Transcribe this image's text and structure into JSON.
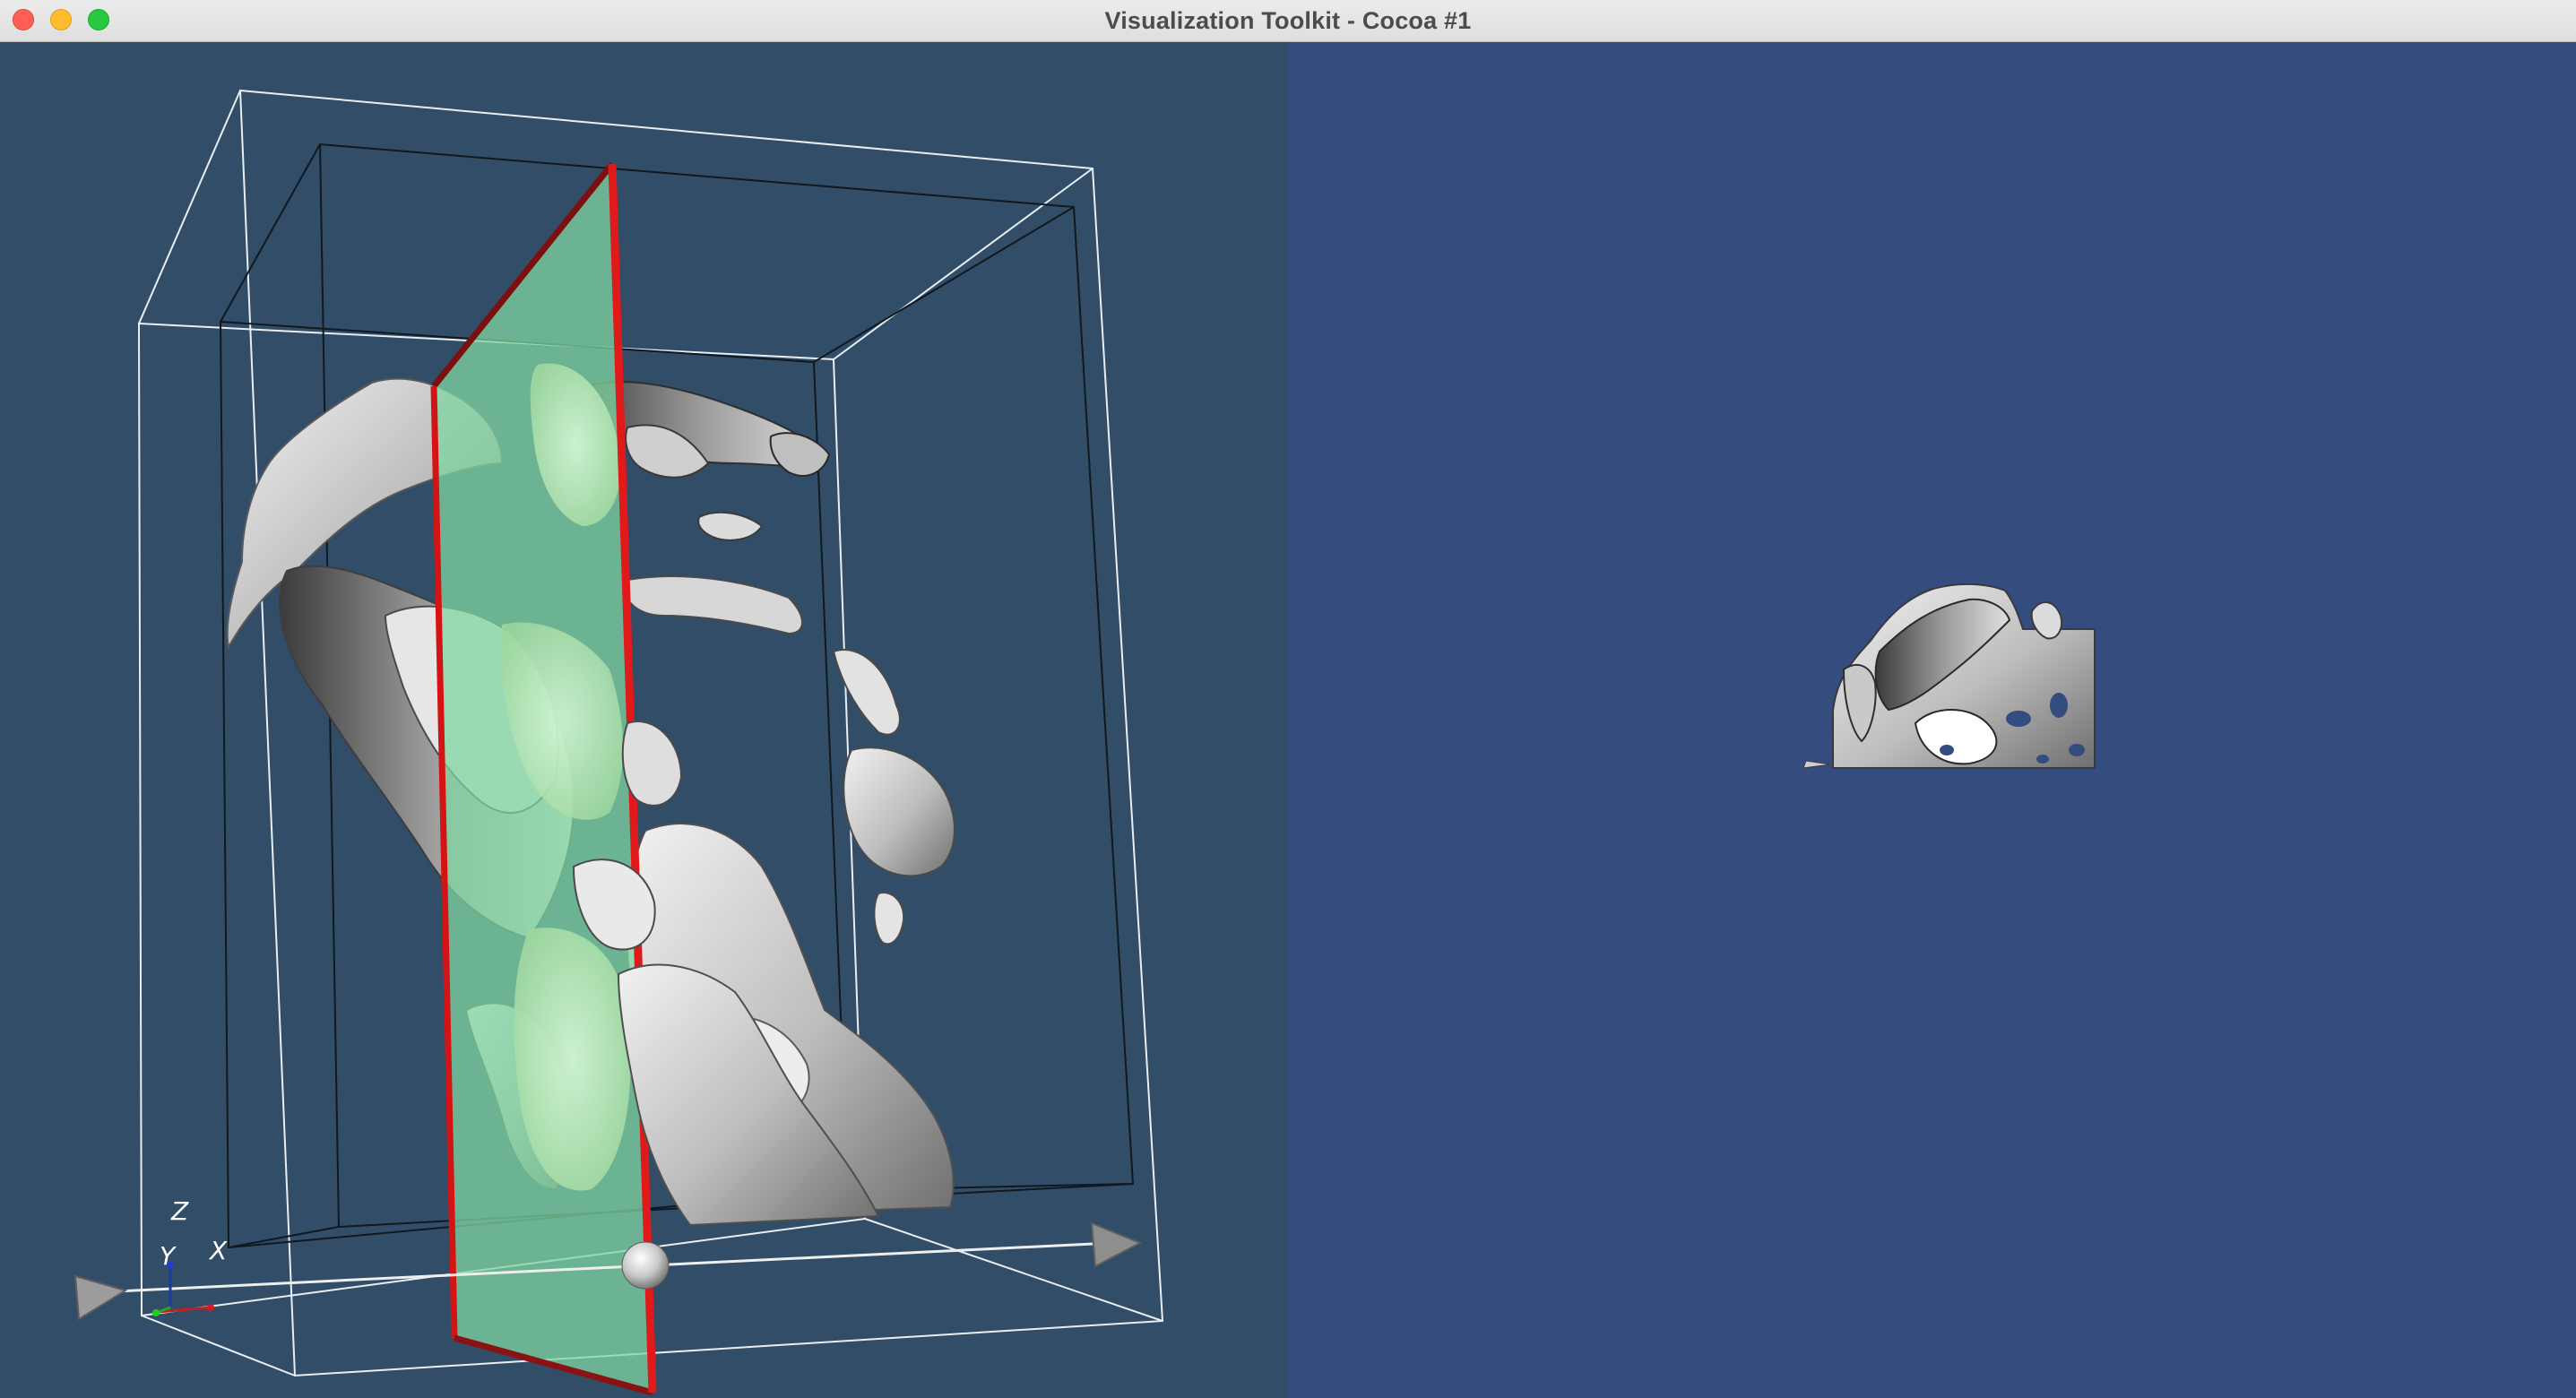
{
  "window": {
    "title": "Visualization Toolkit - Cocoa #1"
  },
  "orientation_axes": {
    "z_label": "Z",
    "y_label": "Y",
    "x_label": "X"
  },
  "colors": {
    "left_background": "#324d67",
    "right_background": "#344c7e",
    "plane_fill": "#7fd6a0",
    "plane_outline": "#e01010",
    "surface": "#d9d9d9"
  },
  "icons": {
    "close": "close-icon",
    "minimize": "minimize-icon",
    "maximize": "maximize-icon"
  }
}
